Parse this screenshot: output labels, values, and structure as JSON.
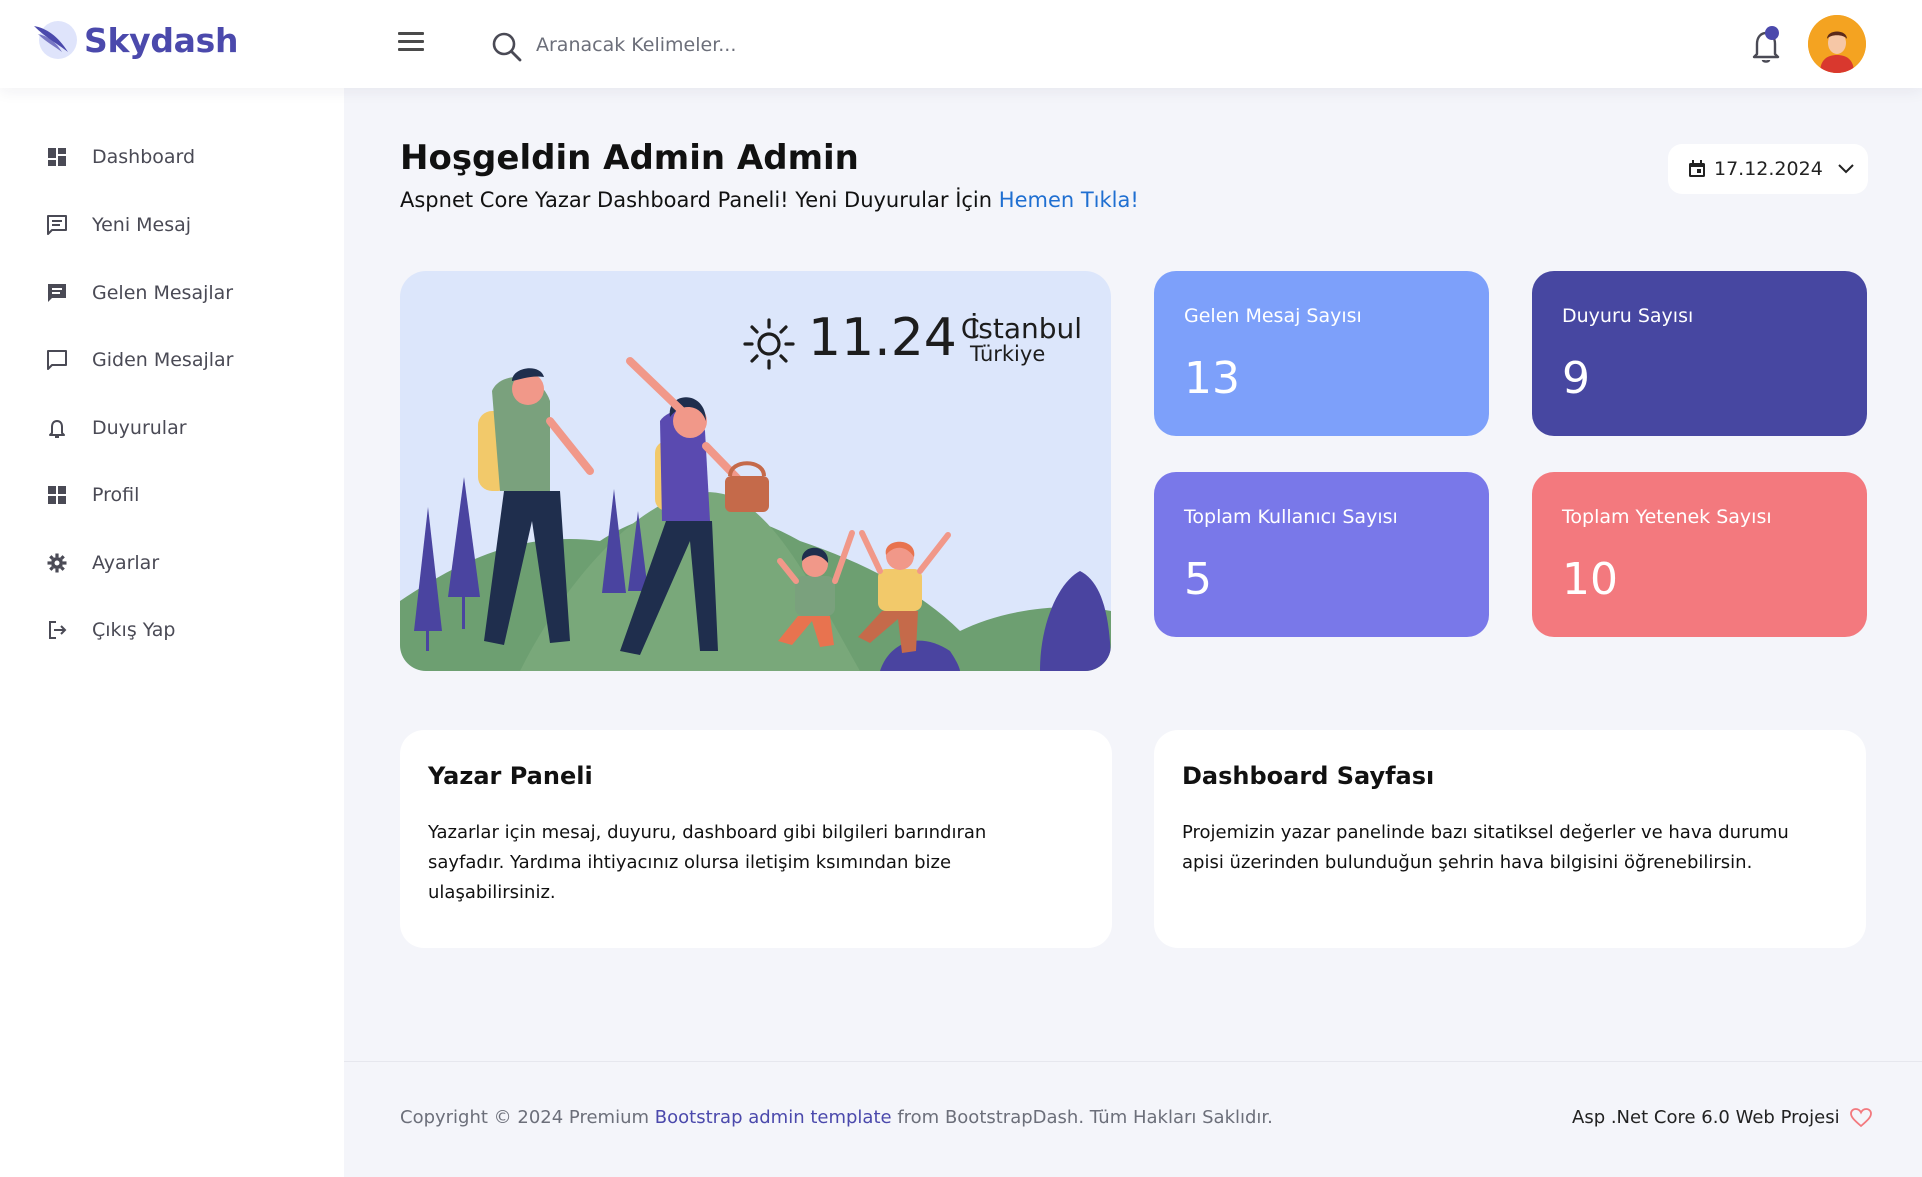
{
  "brand": {
    "name": "Skydash"
  },
  "search": {
    "placeholder": "Aranacak Kelimeler..."
  },
  "sidebar": {
    "items": [
      {
        "label": "Dashboard",
        "icon": "dashboard-icon"
      },
      {
        "label": "Yeni Mesaj",
        "icon": "message-icon"
      },
      {
        "label": "Gelen Mesajlar",
        "icon": "inbox-message-icon"
      },
      {
        "label": "Giden Mesajlar",
        "icon": "outbox-message-icon"
      },
      {
        "label": "Duyurular",
        "icon": "bell-icon"
      },
      {
        "label": "Profil",
        "icon": "grid-icon"
      },
      {
        "label": "Ayarlar",
        "icon": "gear-icon"
      },
      {
        "label": "Çıkış Yap",
        "icon": "logout-icon"
      }
    ]
  },
  "welcome": {
    "title": "Hoşgeldin Admin Admin",
    "subtitle": "Aspnet Core Yazar Dashboard Paneli! Yeni Duyurular İçin",
    "link": "Hemen Tıkla!"
  },
  "date": {
    "value": "17.12.2024"
  },
  "weather": {
    "temp": "11.24",
    "unit": "C",
    "city": "İstanbul",
    "country": "Türkiye"
  },
  "stats": [
    {
      "label": "Gelen Mesaj Sayısı",
      "value": "13",
      "color": "#7da0fa"
    },
    {
      "label": "Duyuru Sayısı",
      "value": "9",
      "color": "#4747a1"
    },
    {
      "label": "Toplam Kullanıcı Sayısı",
      "value": "5",
      "color": "#7978e9"
    },
    {
      "label": "Toplam Yetenek Sayısı",
      "value": "10",
      "color": "#f3797e"
    }
  ],
  "info": [
    {
      "title": "Yazar Paneli",
      "text": "Yazarlar için mesaj, duyuru, dashboard gibi bilgileri barındıran sayfadır. Yardıma ihtiyacınız olursa iletişim ksımından bize ulaşabilirsiniz."
    },
    {
      "title": "Dashboard Sayfası",
      "text": "Projemizin yazar panelinde bazı sitatiksel değerler ve hava durumu apisi üzerinden bulunduğun şehrin hava bilgisini öğrenebilirsin."
    }
  ],
  "footer": {
    "copyright_pre": "Copyright © 2024 Premium",
    "copyright_link": "Bootstrap admin template",
    "copyright_post": "from BootstrapDash. Tüm Hakları Saklıdır.",
    "right": "Asp .Net Core 6.0 Web Projesi"
  }
}
